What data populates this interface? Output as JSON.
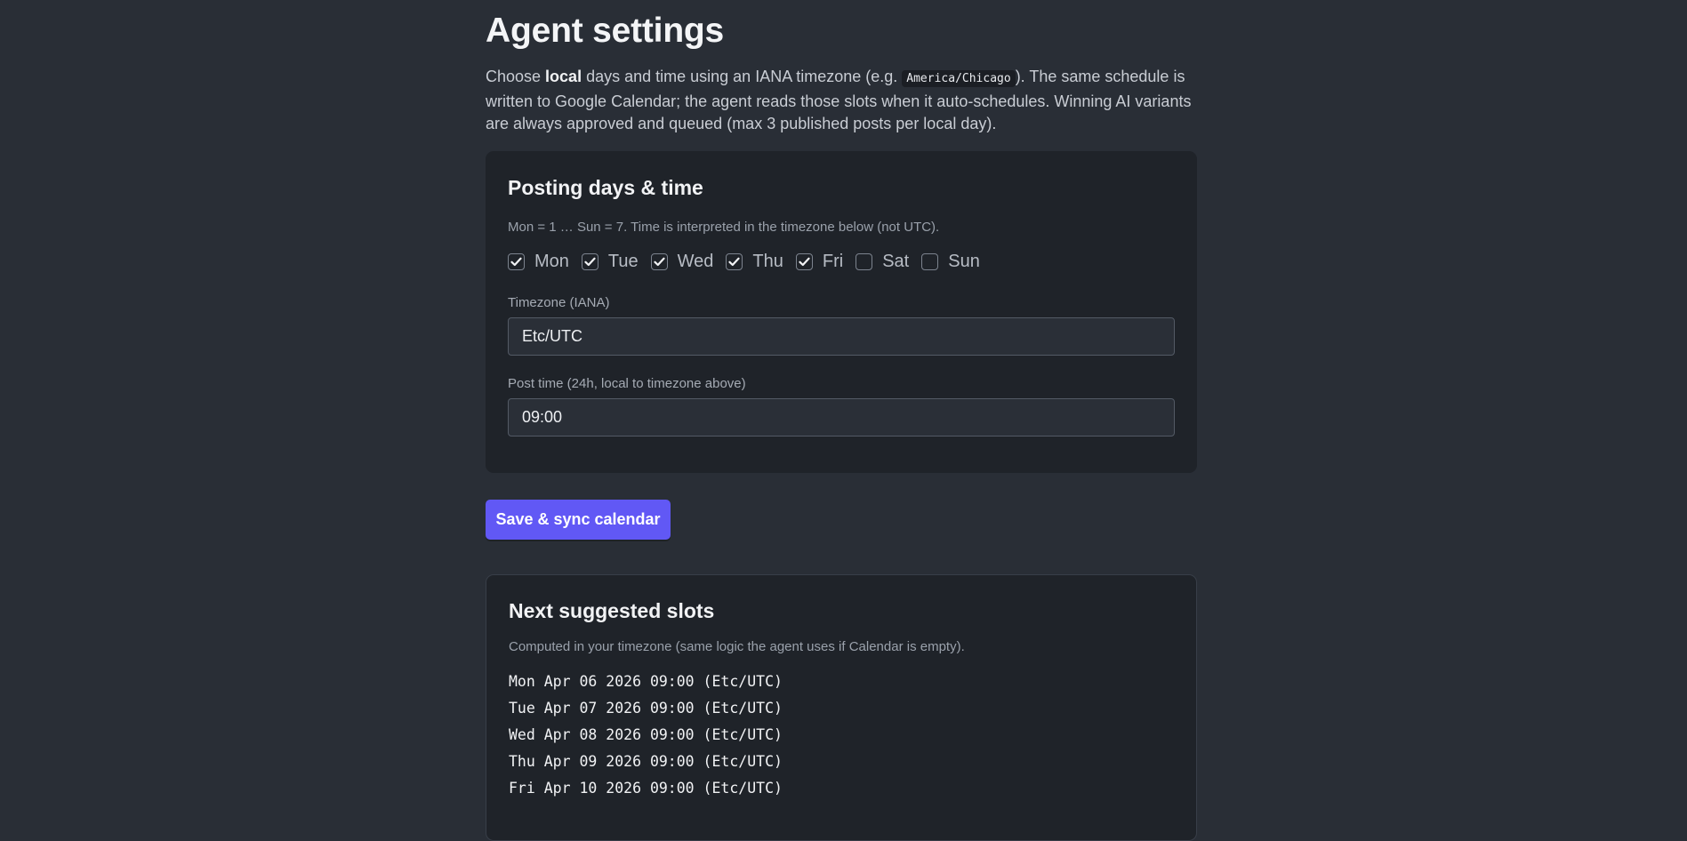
{
  "page": {
    "title": "Agent settings",
    "intro": {
      "part1": "Choose ",
      "bold": "local",
      "part2": " days and time using an IANA timezone (e.g. ",
      "code": "America/Chicago",
      "part3": "). The same schedule is written to Google Calendar; the agent reads those slots when it auto-schedules. Winning AI variants are always approved and queued (max 3 published posts per local day)."
    }
  },
  "schedule_card": {
    "title": "Posting days & time",
    "hint": "Mon = 1 … Sun = 7. Time is interpreted in the timezone below (not UTC).",
    "days": [
      {
        "label": "Mon",
        "checked": true
      },
      {
        "label": "Tue",
        "checked": true
      },
      {
        "label": "Wed",
        "checked": true
      },
      {
        "label": "Thu",
        "checked": true
      },
      {
        "label": "Fri",
        "checked": true
      },
      {
        "label": "Sat",
        "checked": false
      },
      {
        "label": "Sun",
        "checked": false
      }
    ],
    "timezone": {
      "label": "Timezone (IANA)",
      "value": "Etc/UTC"
    },
    "post_time": {
      "label": "Post time (24h, local to timezone above)",
      "value": "09:00"
    }
  },
  "actions": {
    "save_label": "Save & sync calendar"
  },
  "slots_card": {
    "title": "Next suggested slots",
    "hint": "Computed in your timezone (same logic the agent uses if Calendar is empty).",
    "slots": [
      "Mon Apr 06 2026 09:00 (Etc/UTC)",
      "Tue Apr 07 2026 09:00 (Etc/UTC)",
      "Wed Apr 08 2026 09:00 (Etc/UTC)",
      "Thu Apr 09 2026 09:00 (Etc/UTC)",
      "Fri Apr 10 2026 09:00 (Etc/UTC)"
    ]
  },
  "colors": {
    "background": "#292e36",
    "card": "#1f2329",
    "accent": "#6158f5"
  }
}
